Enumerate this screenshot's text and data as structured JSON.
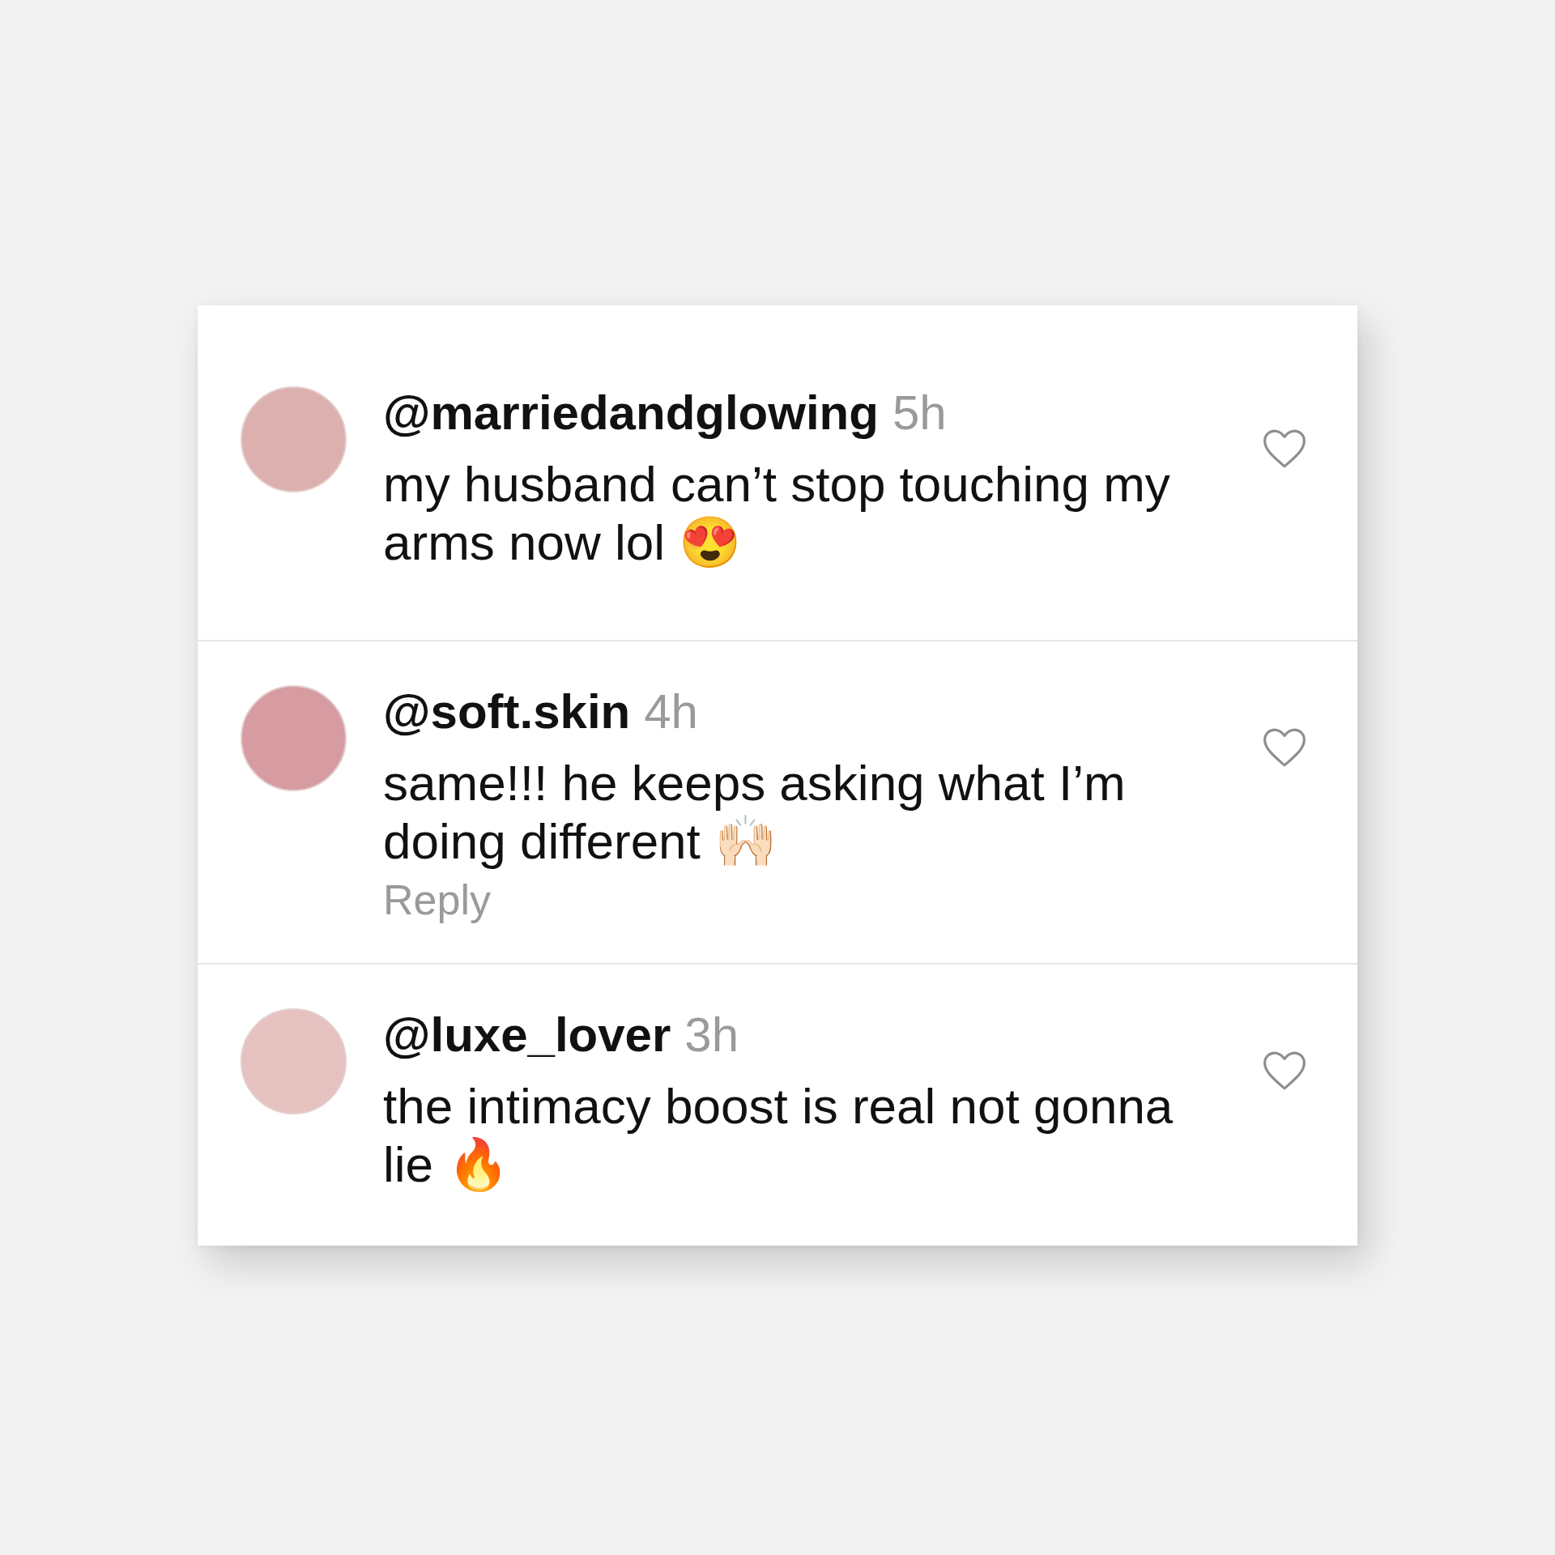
{
  "comments": [
    {
      "avatar": {
        "color": "#dcb0ae"
      },
      "username": "@marriedandglowing",
      "time": "5h",
      "text": "my husband can’t stop touching my arms now lol 😍",
      "liked": false
    },
    {
      "avatar": {
        "color": "#d69ca1"
      },
      "username": "@soft.skin",
      "time": "4h",
      "text": "same!!! he keeps asking what I’m doing different 🙌🏻",
      "reply": "Reply",
      "liked": false
    },
    {
      "avatar": {
        "color": "#e5c2c0"
      },
      "username": "@luxe_lover",
      "time": "3h",
      "text": "the intimacy boost is real not gonna lie 🔥",
      "liked": false
    }
  ]
}
